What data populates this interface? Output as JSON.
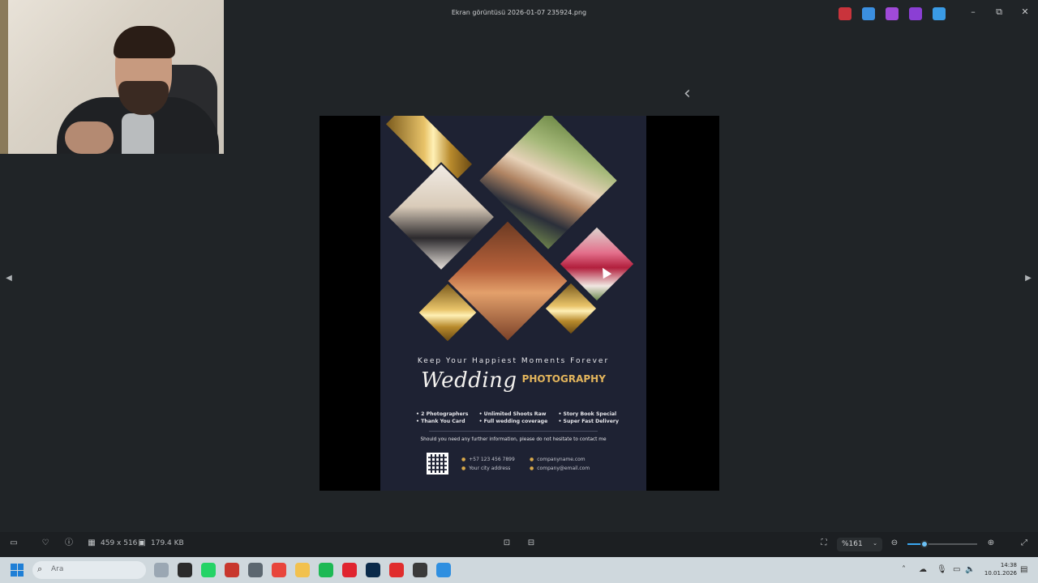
{
  "window": {
    "title": "Ekran görüntüsü 2026-01-07 235924.png",
    "controls": {
      "minimize": "–",
      "restore": "⧉",
      "close": "✕"
    },
    "app_icons": [
      {
        "name": "copilot-icon",
        "color": "#c9343c"
      },
      {
        "name": "pencil-draw-icon",
        "color": "#3b8fe0"
      },
      {
        "name": "designer-icon",
        "color": "#a04ad8"
      },
      {
        "name": "clipchamp-icon",
        "color": "#8b3fd4"
      },
      {
        "name": "onedrive-icon",
        "color": "#3a9be6"
      }
    ]
  },
  "viewer": {
    "back_chevron": "‹",
    "prev_arrow": "◀",
    "next_arrow": "▶"
  },
  "poster": {
    "tagline": "Keep Your Happiest Moments Forever",
    "headline_script": "Wedding",
    "headline_bold": "PHOTOGRAPHY",
    "services": [
      [
        "• 2 Photographers",
        "• Thank You Card"
      ],
      [
        "• Unlimited Shoots Raw",
        "• Full wedding coverage"
      ],
      [
        "• Story Book Special",
        "• Super Fast Delivery"
      ]
    ],
    "note": "Should you need any further information, please do not hesitate to contact me",
    "contact_left": [
      "+57 123 456 7899",
      "Your city address"
    ],
    "contact_right": [
      "companyname.com",
      "company@email.com"
    ],
    "gold_color": "#e3b55c",
    "background_color": "#1e2233"
  },
  "toolbar": {
    "dimensions": "459 x 516",
    "file_size": "179.4 KB",
    "zoom": "%161",
    "zoom_slider_fraction": 0.24
  },
  "taskbar": {
    "search_placeholder": "Ara",
    "time": "14:38",
    "date": "10.01.2026",
    "apps": [
      {
        "name": "weather-widget-icon",
        "color": "#9aa7b3"
      },
      {
        "name": "file-explorer-dark-icon",
        "color": "#2b2b2b"
      },
      {
        "name": "whatsapp-icon",
        "color": "#25d366"
      },
      {
        "name": "news-app-icon",
        "color": "#c8372d"
      },
      {
        "name": "calculator-icon",
        "color": "#5c6770"
      },
      {
        "name": "chrome-icon",
        "color": "#e8453c"
      },
      {
        "name": "folder-icon",
        "color": "#f2c14e"
      },
      {
        "name": "spotify-icon",
        "color": "#1db954"
      },
      {
        "name": "opera-icon",
        "color": "#e0242f"
      },
      {
        "name": "photoshop-icon",
        "color": "#0a2a4a"
      },
      {
        "name": "wps-office-icon",
        "color": "#e02d2d"
      },
      {
        "name": "davinci-resolve-icon",
        "color": "#3a3a3a"
      },
      {
        "name": "paint-app-icon",
        "color": "#2f8fe0"
      }
    ]
  }
}
